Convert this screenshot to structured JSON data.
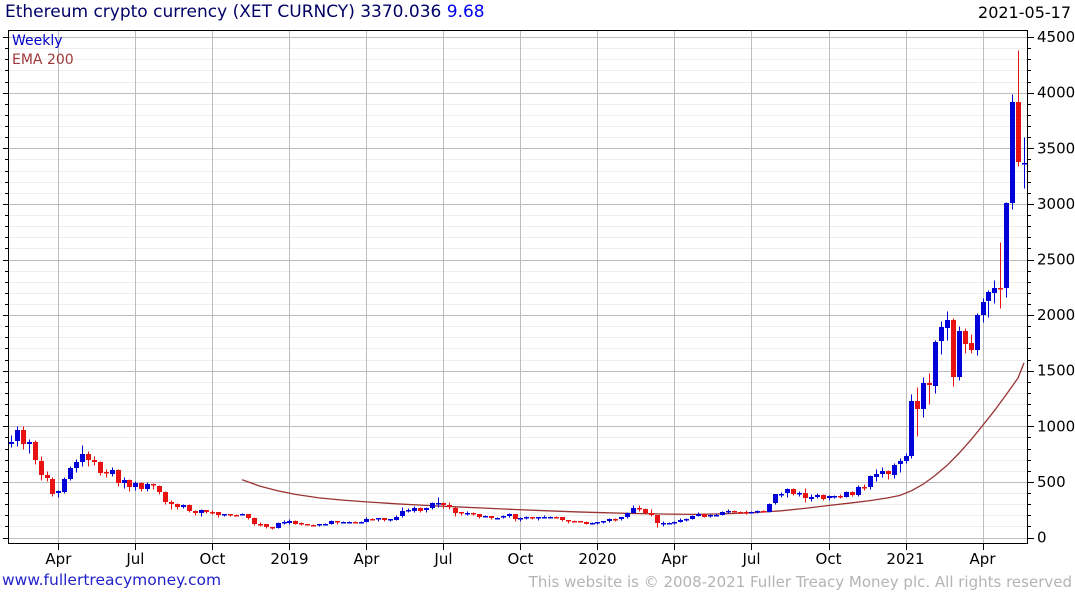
{
  "header": {
    "title": "Ethereum crypto currency  (XET CURNCY)",
    "price": "3370.036",
    "change": "9.68",
    "date": "2021-05-17"
  },
  "legend": {
    "series_label": "Weekly",
    "overlay_label": "EMA 200"
  },
  "footer": {
    "site_link": "www.fullertreacymoney.com",
    "copyright": "This website is © 2008-2021 Fuller Treacy Money plc. All rights reserved"
  },
  "colors": {
    "title": "#000066",
    "change": "#0000ee",
    "grid_minor": "#ededed",
    "grid_major": "#bdbdbd",
    "axis": "#000000",
    "footer_gray": "#b4b4b4",
    "link_blue": "#2222cc"
  },
  "chart_data": {
    "type": "candlestick",
    "title": "Ethereum crypto currency (XET CURNCY)",
    "interval": "weekly",
    "start_date": "2018-02-05",
    "end_date": "2021-05-17",
    "ylim": [
      0,
      4500
    ],
    "y_major_step": 500,
    "y_minor_step": 100,
    "y_tick_labels": [
      "0",
      "500",
      "1000",
      "1500",
      "2000",
      "2500",
      "3000",
      "3500",
      "4000",
      "4500"
    ],
    "legend_position": "top-left",
    "grid": true,
    "up_color": "#0000d8",
    "down_color": "#e81212",
    "ema_color": "#993333",
    "x_ticks": [
      {
        "index": 8,
        "label": "Apr"
      },
      {
        "index": 21,
        "label": "Jul"
      },
      {
        "index": 34,
        "label": "Oct"
      },
      {
        "index": 47,
        "label": "2019"
      },
      {
        "index": 60,
        "label": "Apr"
      },
      {
        "index": 73,
        "label": "Jul"
      },
      {
        "index": 86,
        "label": "Oct"
      },
      {
        "index": 99,
        "label": "2020"
      },
      {
        "index": 112,
        "label": "Apr"
      },
      {
        "index": 125,
        "label": "Jul"
      },
      {
        "index": 138,
        "label": "Oct"
      },
      {
        "index": 151,
        "label": "2021"
      },
      {
        "index": 164,
        "label": "Apr"
      }
    ],
    "candles_format": [
      "open",
      "high",
      "low",
      "close"
    ],
    "candles": [
      [
        845,
        925,
        815,
        862
      ],
      [
        862,
        1000,
        820,
        965
      ],
      [
        965,
        1005,
        795,
        840
      ],
      [
        840,
        890,
        760,
        856
      ],
      [
        856,
        880,
        665,
        690
      ],
      [
        690,
        730,
        520,
        560
      ],
      [
        560,
        595,
        505,
        530
      ],
      [
        530,
        545,
        370,
        395
      ],
      [
        395,
        430,
        365,
        415
      ],
      [
        415,
        545,
        400,
        530
      ],
      [
        530,
        640,
        515,
        625
      ],
      [
        625,
        710,
        590,
        680
      ],
      [
        680,
        830,
        640,
        755
      ],
      [
        755,
        780,
        640,
        700
      ],
      [
        700,
        735,
        655,
        680
      ],
      [
        680,
        690,
        560,
        585
      ],
      [
        585,
        620,
        545,
        575
      ],
      [
        575,
        630,
        555,
        610
      ],
      [
        610,
        615,
        460,
        490
      ],
      [
        490,
        540,
        445,
        515
      ],
      [
        515,
        525,
        420,
        455
      ],
      [
        455,
        510,
        430,
        490
      ],
      [
        490,
        495,
        420,
        432
      ],
      [
        432,
        500,
        415,
        478
      ],
      [
        478,
        490,
        440,
        465
      ],
      [
        465,
        470,
        395,
        410
      ],
      [
        410,
        420,
        300,
        318
      ],
      [
        318,
        335,
        255,
        300
      ],
      [
        300,
        310,
        260,
        273
      ],
      [
        273,
        305,
        265,
        295
      ],
      [
        295,
        300,
        225,
        238
      ],
      [
        238,
        250,
        205,
        222
      ],
      [
        222,
        255,
        195,
        245
      ],
      [
        245,
        250,
        220,
        231
      ],
      [
        231,
        245,
        215,
        226
      ],
      [
        226,
        230,
        188,
        199
      ],
      [
        199,
        215,
        192,
        208
      ],
      [
        208,
        212,
        196,
        204
      ],
      [
        204,
        210,
        192,
        200
      ],
      [
        200,
        222,
        198,
        212
      ],
      [
        212,
        214,
        170,
        178
      ],
      [
        178,
        180,
        112,
        123
      ],
      [
        123,
        135,
        104,
        117
      ],
      [
        117,
        120,
        82,
        92
      ],
      [
        92,
        98,
        80,
        85
      ],
      [
        85,
        140,
        82,
        128
      ],
      [
        128,
        160,
        118,
        137
      ],
      [
        137,
        162,
        125,
        152
      ],
      [
        152,
        158,
        122,
        128
      ],
      [
        128,
        136,
        112,
        118
      ],
      [
        118,
        125,
        108,
        116
      ],
      [
        116,
        120,
        102,
        107
      ],
      [
        107,
        125,
        102,
        119
      ],
      [
        119,
        130,
        115,
        122
      ],
      [
        122,
        155,
        118,
        148
      ],
      [
        148,
        152,
        125,
        136
      ],
      [
        136,
        145,
        128,
        138
      ],
      [
        138,
        144,
        130,
        139
      ],
      [
        139,
        145,
        132,
        136
      ],
      [
        136,
        148,
        128,
        142
      ],
      [
        142,
        185,
        140,
        166
      ],
      [
        166,
        175,
        155,
        164
      ],
      [
        164,
        178,
        152,
        172
      ],
      [
        172,
        178,
        148,
        157
      ],
      [
        157,
        170,
        150,
        163
      ],
      [
        163,
        200,
        156,
        188
      ],
      [
        188,
        270,
        182,
        234
      ],
      [
        234,
        262,
        225,
        245
      ],
      [
        245,
        285,
        232,
        268
      ],
      [
        268,
        275,
        226,
        245
      ],
      [
        245,
        275,
        228,
        266
      ],
      [
        266,
        320,
        258,
        308
      ],
      [
        308,
        364,
        275,
        310
      ],
      [
        310,
        315,
        262,
        288
      ],
      [
        288,
        320,
        255,
        268
      ],
      [
        268,
        272,
        192,
        225
      ],
      [
        225,
        232,
        200,
        218
      ],
      [
        218,
        238,
        205,
        222
      ],
      [
        222,
        230,
        202,
        209
      ],
      [
        209,
        212,
        178,
        185
      ],
      [
        185,
        202,
        180,
        190
      ],
      [
        190,
        194,
        162,
        172
      ],
      [
        172,
        184,
        165,
        178
      ],
      [
        178,
        198,
        172,
        189
      ],
      [
        189,
        222,
        185,
        210
      ],
      [
        210,
        212,
        152,
        165
      ],
      [
        165,
        185,
        152,
        176
      ],
      [
        176,
        196,
        170,
        180
      ],
      [
        180,
        188,
        165,
        172
      ],
      [
        172,
        188,
        158,
        181
      ],
      [
        181,
        198,
        174,
        183
      ],
      [
        183,
        192,
        178,
        185
      ],
      [
        185,
        190,
        175,
        180
      ],
      [
        180,
        182,
        146,
        154
      ],
      [
        154,
        160,
        132,
        151
      ],
      [
        151,
        155,
        142,
        147
      ],
      [
        147,
        152,
        138,
        142
      ],
      [
        142,
        145,
        118,
        127
      ],
      [
        127,
        138,
        121,
        132
      ],
      [
        132,
        142,
        125,
        136
      ],
      [
        136,
        148,
        132,
        145
      ],
      [
        145,
        178,
        140,
        166
      ],
      [
        166,
        175,
        152,
        162
      ],
      [
        162,
        188,
        156,
        183
      ],
      [
        183,
        230,
        178,
        223
      ],
      [
        223,
        290,
        216,
        265
      ],
      [
        265,
        288,
        242,
        256
      ],
      [
        256,
        262,
        208,
        217
      ],
      [
        217,
        252,
        192,
        199
      ],
      [
        199,
        202,
        95,
        124
      ],
      [
        124,
        152,
        102,
        129
      ],
      [
        129,
        142,
        120,
        130
      ],
      [
        130,
        148,
        124,
        142
      ],
      [
        142,
        172,
        136,
        158
      ],
      [
        158,
        178,
        148,
        170
      ],
      [
        170,
        200,
        166,
        194
      ],
      [
        194,
        228,
        190,
        211
      ],
      [
        211,
        218,
        180,
        188
      ],
      [
        188,
        208,
        182,
        200
      ],
      [
        200,
        218,
        192,
        206
      ],
      [
        206,
        238,
        198,
        230
      ],
      [
        230,
        252,
        222,
        240
      ],
      [
        240,
        250,
        225,
        231
      ],
      [
        231,
        236,
        218,
        228
      ],
      [
        228,
        248,
        215,
        224
      ],
      [
        224,
        234,
        216,
        227
      ],
      [
        227,
        248,
        222,
        240
      ],
      [
        240,
        245,
        228,
        233
      ],
      [
        233,
        312,
        228,
        305
      ],
      [
        305,
        395,
        298,
        387
      ],
      [
        387,
        412,
        365,
        395
      ],
      [
        395,
        445,
        362,
        433
      ],
      [
        433,
        448,
        380,
        392
      ],
      [
        392,
        415,
        372,
        399
      ],
      [
        399,
        445,
        316,
        352
      ],
      [
        352,
        395,
        330,
        368
      ],
      [
        368,
        398,
        355,
        384
      ],
      [
        384,
        390,
        335,
        352
      ],
      [
        352,
        382,
        340,
        370
      ],
      [
        370,
        385,
        352,
        374
      ],
      [
        374,
        395,
        358,
        368
      ],
      [
        368,
        420,
        362,
        412
      ],
      [
        412,
        418,
        372,
        386
      ],
      [
        386,
        470,
        370,
        455
      ],
      [
        455,
        478,
        428,
        448
      ],
      [
        448,
        560,
        440,
        550
      ],
      [
        550,
        620,
        512,
        575
      ],
      [
        575,
        635,
        546,
        598
      ],
      [
        598,
        605,
        528,
        568
      ],
      [
        568,
        672,
        535,
        655
      ],
      [
        655,
        715,
        585,
        685
      ],
      [
        685,
        758,
        670,
        730
      ],
      [
        730,
        1290,
        718,
        1225
      ],
      [
        1225,
        1350,
        915,
        1155
      ],
      [
        1155,
        1440,
        1085,
        1390
      ],
      [
        1390,
        1480,
        1205,
        1368
      ],
      [
        1368,
        1780,
        1295,
        1760
      ],
      [
        1760,
        1950,
        1650,
        1890
      ],
      [
        1890,
        2040,
        1780,
        1960
      ],
      [
        1960,
        1975,
        1360,
        1445
      ],
      [
        1445,
        1900,
        1415,
        1860
      ],
      [
        1860,
        1880,
        1660,
        1745
      ],
      [
        1745,
        1830,
        1655,
        1685
      ],
      [
        1685,
        2020,
        1645,
        2000
      ],
      [
        2000,
        2150,
        1940,
        2120
      ],
      [
        2120,
        2230,
        1985,
        2205
      ],
      [
        2205,
        2320,
        2105,
        2248
      ],
      [
        2248,
        2660,
        2065,
        2240
      ],
      [
        2240,
        3020,
        2160,
        3005
      ],
      [
        3005,
        3990,
        2950,
        3915
      ],
      [
        3915,
        4380,
        3340,
        3375
      ],
      [
        3362,
        3600,
        3140,
        3370
      ]
    ],
    "ema200_points_format": [
      "week_index",
      "value"
    ],
    "ema200": [
      [
        39,
        520
      ],
      [
        42,
        462
      ],
      [
        45,
        420
      ],
      [
        48,
        388
      ],
      [
        52,
        356
      ],
      [
        56,
        336
      ],
      [
        60,
        320
      ],
      [
        65,
        303
      ],
      [
        70,
        289
      ],
      [
        75,
        276
      ],
      [
        80,
        264
      ],
      [
        85,
        252
      ],
      [
        90,
        241
      ],
      [
        95,
        231
      ],
      [
        100,
        223
      ],
      [
        105,
        216
      ],
      [
        110,
        211
      ],
      [
        115,
        208
      ],
      [
        120,
        212
      ],
      [
        125,
        222
      ],
      [
        130,
        240
      ],
      [
        134,
        262
      ],
      [
        138,
        288
      ],
      [
        142,
        312
      ],
      [
        145,
        332
      ],
      [
        148,
        356
      ],
      [
        150,
        378
      ],
      [
        152,
        420
      ],
      [
        154,
        480
      ],
      [
        156,
        558
      ],
      [
        158,
        648
      ],
      [
        160,
        755
      ],
      [
        162,
        875
      ],
      [
        164,
        1005
      ],
      [
        166,
        1140
      ],
      [
        168,
        1285
      ],
      [
        170,
        1435
      ],
      [
        171,
        1570
      ]
    ]
  }
}
